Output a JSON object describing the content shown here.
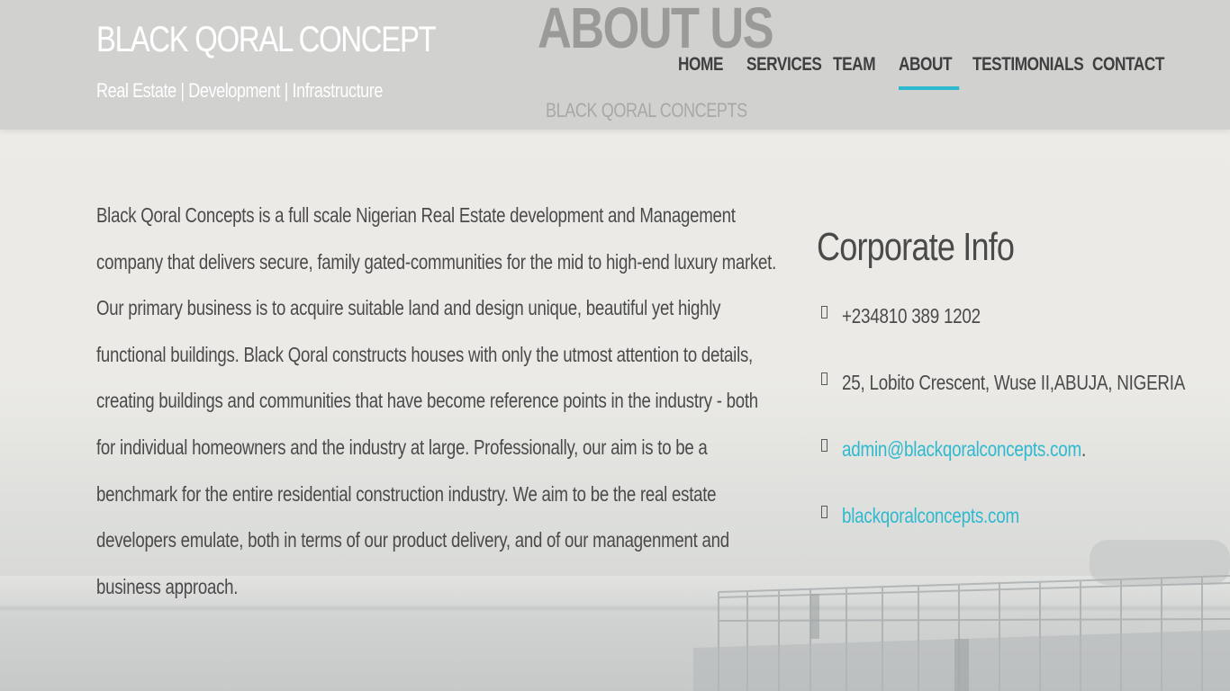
{
  "header": {
    "brand_title": "BLACK QORAL CONCEPT",
    "brand_tagline": "Real Estate | Development | Infrastructure",
    "hero_title": "ABOUT US",
    "hero_subtitle": "BLACK QORAL CONCEPTS",
    "nav": [
      {
        "label": "HOME",
        "active": false
      },
      {
        "label": "SERVICES",
        "active": false
      },
      {
        "label": "TEAM",
        "active": false
      },
      {
        "label": "ABOUT",
        "active": true
      },
      {
        "label": "TESTIMONIALS",
        "active": false
      },
      {
        "label": "CONTACT",
        "active": false
      }
    ]
  },
  "about": {
    "body": "Black Qoral Concepts is a full scale Nigerian Real Estate development and Management company that delivers secure, family gated-communities for the mid to high-end luxury market. Our primary business is to acquire suitable land and design unique, beautiful yet highly functional buildings. Black Qoral constructs houses with only the utmost attention to details, creating buildings and communities that have become reference points in the industry - both for individual homeowners and the industry at large. Professionally, our aim is to be a benchmark for the entire residential construction industry. We aim to be the real estate developers emulate, both in terms of our product delivery, and of our managenment and business approach."
  },
  "corporate_info": {
    "heading": "Corporate Info",
    "phone": "+234810 389 1202",
    "address": "25, Lobito Crescent, Wuse II,ABUJA, NIGERIA",
    "email": "admin@blackqoralconcepts.com",
    "email_suffix": ".",
    "website": "blackqoralconcepts.com"
  },
  "colors": {
    "accent": "#2fb9cf",
    "text": "#4a4a4a",
    "header_bg": "#cdcdcb"
  }
}
